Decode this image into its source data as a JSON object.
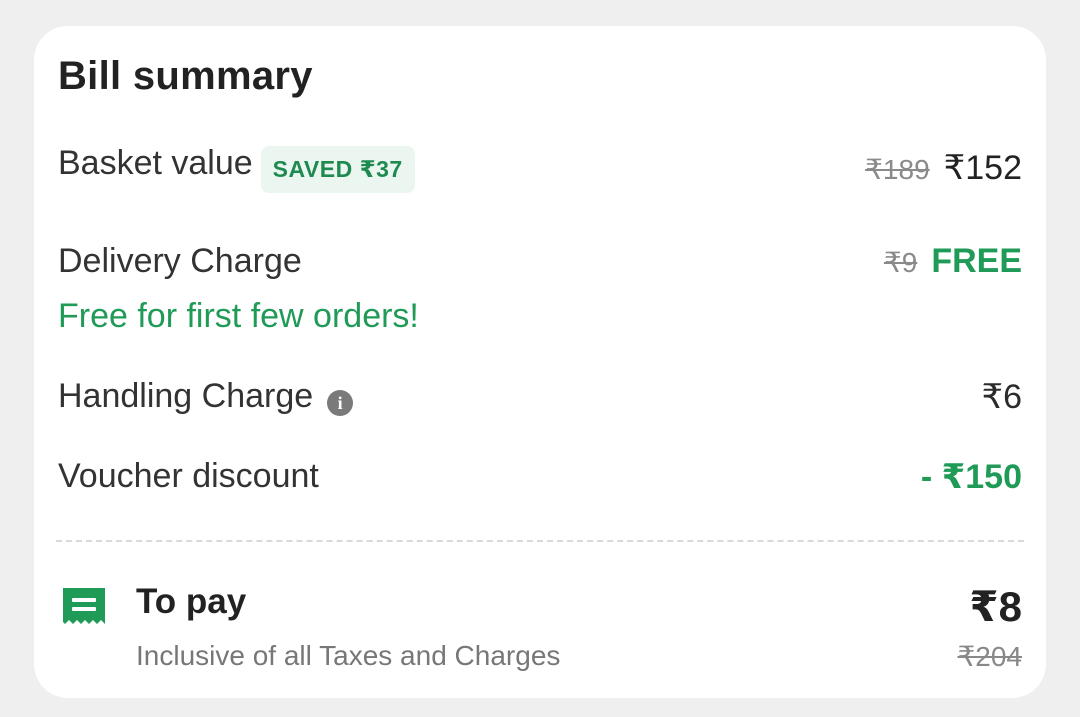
{
  "bill": {
    "title": "Bill summary",
    "basket": {
      "label": "Basket value",
      "badge": "SAVED ₹37",
      "original": "₹189",
      "price": "₹152"
    },
    "delivery": {
      "label": "Delivery Charge",
      "note": "Free for first few orders!",
      "original": "₹9",
      "price": "FREE"
    },
    "handling": {
      "label": "Handling Charge",
      "info_icon": "info-icon",
      "price": "₹6"
    },
    "voucher": {
      "label": "Voucher discount",
      "price": "- ₹150"
    },
    "to_pay": {
      "icon": "receipt-icon",
      "label": "To pay",
      "subtitle": "Inclusive of all Taxes and Charges",
      "amount": "₹8",
      "original": "₹204"
    }
  },
  "colors": {
    "accent_green": "#1f9a57",
    "badge_bg": "#eaf6ef",
    "background": "#efefef"
  }
}
